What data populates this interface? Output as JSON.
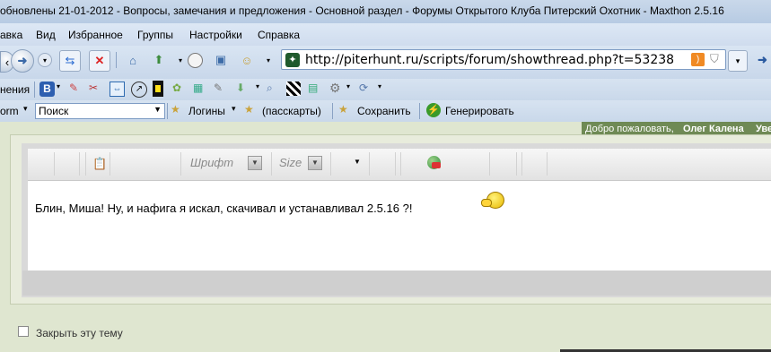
{
  "window": {
    "title": "обновлены 21-01-2012 - Вопросы, замечания и предложения - Основной раздел - Форумы Открытого Клуба Питерский Охотник - Maxthon 2.5.16"
  },
  "menu": {
    "items": [
      "авка",
      "Вид",
      "Избранное",
      "Группы",
      "Настройки",
      "Справка"
    ]
  },
  "address": {
    "url": "http://piterhunt.ru/scripts/forum/showthread.php?t=53238"
  },
  "pluginbar": {
    "label": "нения"
  },
  "searchbar": {
    "form_label": "orm",
    "search_value": "Поиск",
    "logins_label": "Логины",
    "passcards_label": "(пасскарты)",
    "save_label": "Сохранить",
    "generate_label": "Генерировать"
  },
  "forum": {
    "welcome_text": "Добро пожаловать,",
    "username": "Олег Калена",
    "welcome_tail": "Уве"
  },
  "editor": {
    "font_placeholder": "Шрифт",
    "size_placeholder": "Size",
    "message": "Блин, Миша! Ну, и нафига я искал, скачивал и устанавливал 2.5.16 ?!"
  },
  "options": {
    "close_thread_label": "Закрыть эту тему"
  },
  "colors": {
    "titlebar": "#c9d8ea",
    "welcome_bg": "#6f8a55",
    "page_bg": "#dfe6d0"
  }
}
